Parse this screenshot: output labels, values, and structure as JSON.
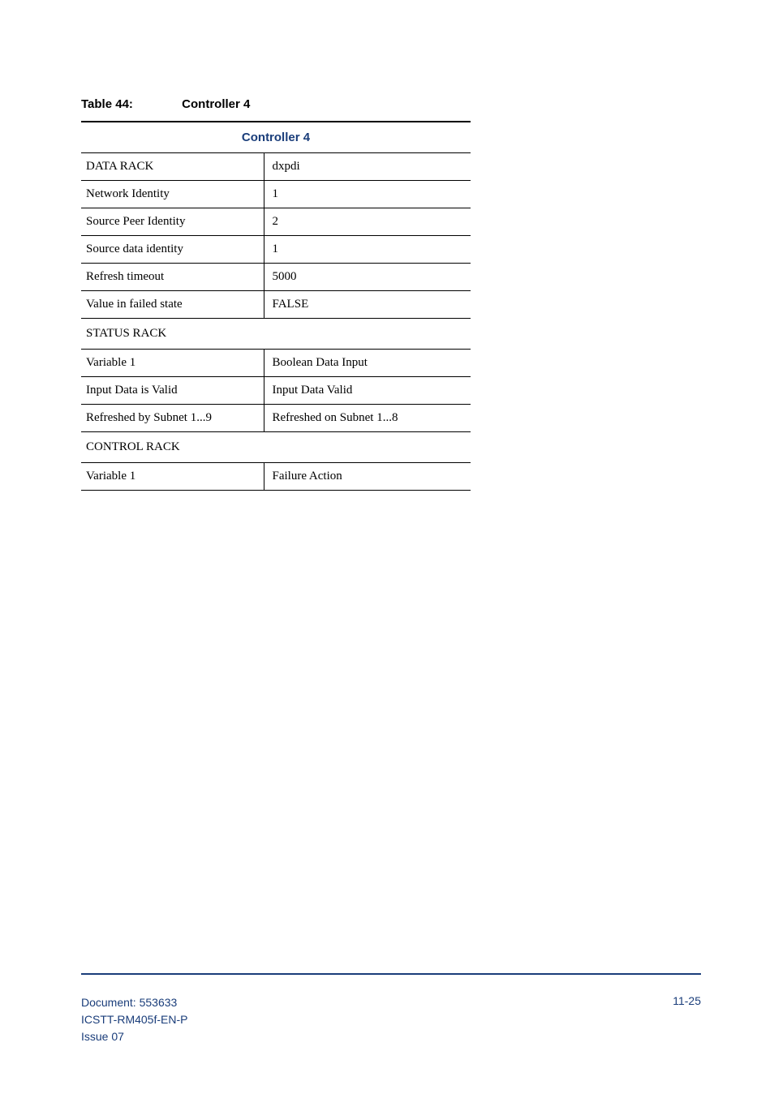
{
  "caption": {
    "label": "Table 44:",
    "title": "Controller 4"
  },
  "header": "Controller 4",
  "rows_data": [
    {
      "label": "DATA RACK",
      "value": "dxpdi"
    },
    {
      "label": "Network Identity",
      "value": "1"
    },
    {
      "label": "Source Peer Identity",
      "value": "2"
    },
    {
      "label": "Source data identity",
      "value": "1"
    },
    {
      "label": "Refresh timeout",
      "value": "5000"
    },
    {
      "label": "Value in failed state",
      "value": "FALSE"
    }
  ],
  "section_status": "STATUS RACK",
  "rows_status": [
    {
      "label": "Variable 1",
      "value": "Boolean Data Input"
    },
    {
      "label": "Input Data is Valid",
      "value": "Input Data Valid"
    },
    {
      "label": "Refreshed by Subnet 1...9",
      "value": "Refreshed on Subnet 1...8"
    }
  ],
  "section_control": "CONTROL RACK",
  "rows_control": [
    {
      "label": "Variable 1",
      "value": "Failure Action"
    }
  ],
  "footer": {
    "doc": "Document: 553633",
    "code": "ICSTT-RM405f-EN-P",
    "issue": " Issue 07",
    "page": "11-25"
  }
}
